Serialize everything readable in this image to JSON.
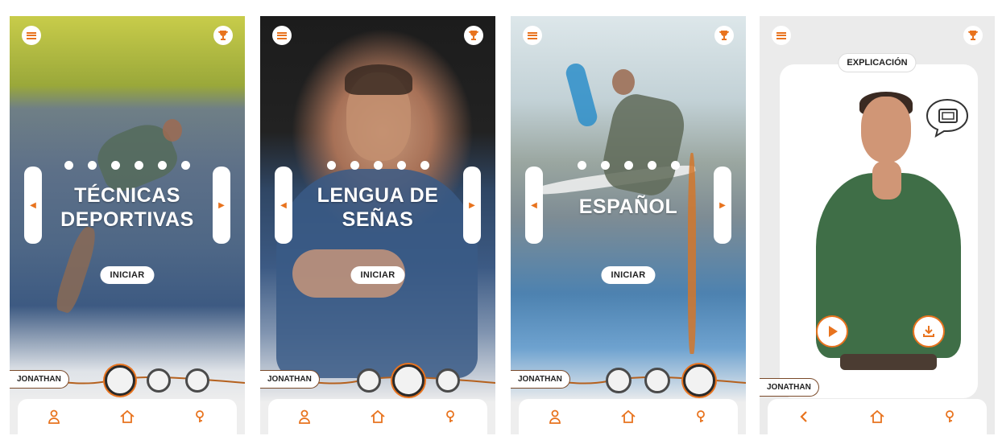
{
  "colors": {
    "accent": "#e8731e",
    "card": "#ffffff",
    "text_dark": "#222222"
  },
  "icons": {
    "menu": "menu-icon",
    "trophy": "trophy-icon",
    "arrow_left": "arrow-left-icon",
    "arrow_right": "arrow-right-icon",
    "user": "user-icon",
    "home": "home-icon",
    "search": "search-icon",
    "back": "back-icon",
    "play": "play-icon",
    "download": "download-icon",
    "chat": "chat-icon"
  },
  "screens": [
    {
      "title_lines": [
        "TÉCNICAS",
        "DEPORTIVAS"
      ],
      "start_label": "INICIAR",
      "user_name": "JONATHAN",
      "dots_count": 6,
      "selected_ball": 1
    },
    {
      "title_lines": [
        "LENGUA DE",
        "SEÑAS"
      ],
      "start_label": "INICIAR",
      "user_name": "JONATHAN",
      "dots_count": 5,
      "selected_ball": 2
    },
    {
      "title_lines": [
        "ESPAÑOL",
        ""
      ],
      "start_label": "INICIAR",
      "user_name": "JONATHAN",
      "dots_count": 5,
      "selected_ball": 3
    },
    {
      "card_label": "EXPLICACIÓN",
      "user_name": "JONATHAN"
    }
  ]
}
